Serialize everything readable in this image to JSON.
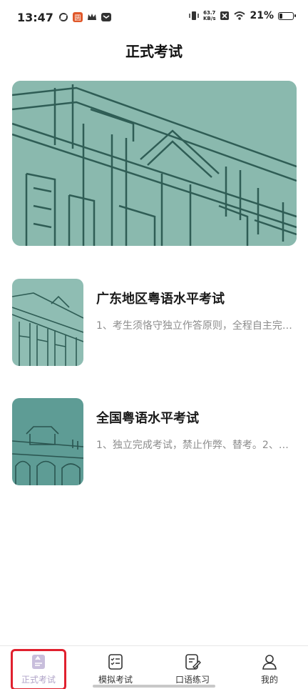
{
  "status_bar": {
    "time": "13:47",
    "speed_value": "63.7",
    "speed_unit": "KB/s",
    "battery_percent": "21%",
    "battery_level": 0.21
  },
  "header": {
    "title": "正式考试"
  },
  "exams": [
    {
      "title": "广东地区粤语水平考试",
      "description": "1、考生须恪守独立作答原则，全程自主完成考试"
    },
    {
      "title": "全国粤语水平考试",
      "description": "1、独立完成考试，禁止作弊、替考。2、考试期间"
    }
  ],
  "nav": {
    "items": [
      {
        "label": "正式考试",
        "icon": "exam-doc-icon",
        "active": true
      },
      {
        "label": "模拟考试",
        "icon": "checklist-icon",
        "active": false
      },
      {
        "label": "口语练习",
        "icon": "edit-note-icon",
        "active": false
      },
      {
        "label": "我的",
        "icon": "user-icon",
        "active": false
      }
    ]
  },
  "colors": {
    "banner_bg": "#8ab9ae",
    "active_tab": "#b0a4c8",
    "highlight": "#e0202e"
  }
}
